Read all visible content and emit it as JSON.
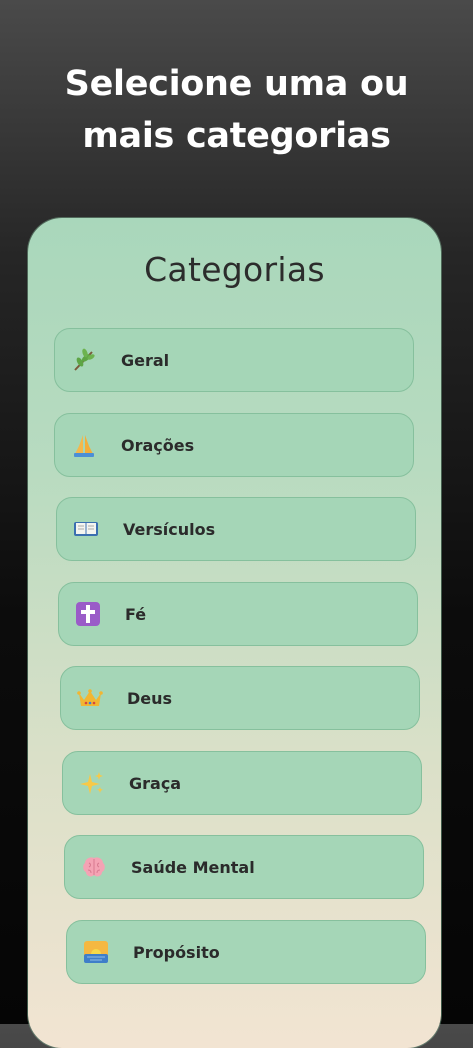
{
  "header": {
    "title_line1": "Selecione uma ou",
    "title_line2": "mais categorias"
  },
  "card": {
    "title": "Categorias"
  },
  "categories": [
    {
      "label": "Geral",
      "icon": "branch-icon",
      "glyph": "🌿"
    },
    {
      "label": "Orações",
      "icon": "praying-hands-icon",
      "glyph": "🙏"
    },
    {
      "label": "Versículos",
      "icon": "book-icon",
      "glyph": "📖"
    },
    {
      "label": "Fé",
      "icon": "cross-icon",
      "glyph": "✝"
    },
    {
      "label": "Deus",
      "icon": "crown-icon",
      "glyph": "👑"
    },
    {
      "label": "Graça",
      "icon": "sparkles-icon",
      "glyph": "✨"
    },
    {
      "label": "Saúde Mental",
      "icon": "brain-icon",
      "glyph": "🧠"
    },
    {
      "label": "Propósito",
      "icon": "sunrise-icon",
      "glyph": "🌅"
    }
  ],
  "colors": {
    "card_top": "#a9d7bb",
    "card_bottom": "#f2e4d2",
    "item_bg": "#a5d6b7",
    "item_border": "#86c09d"
  }
}
